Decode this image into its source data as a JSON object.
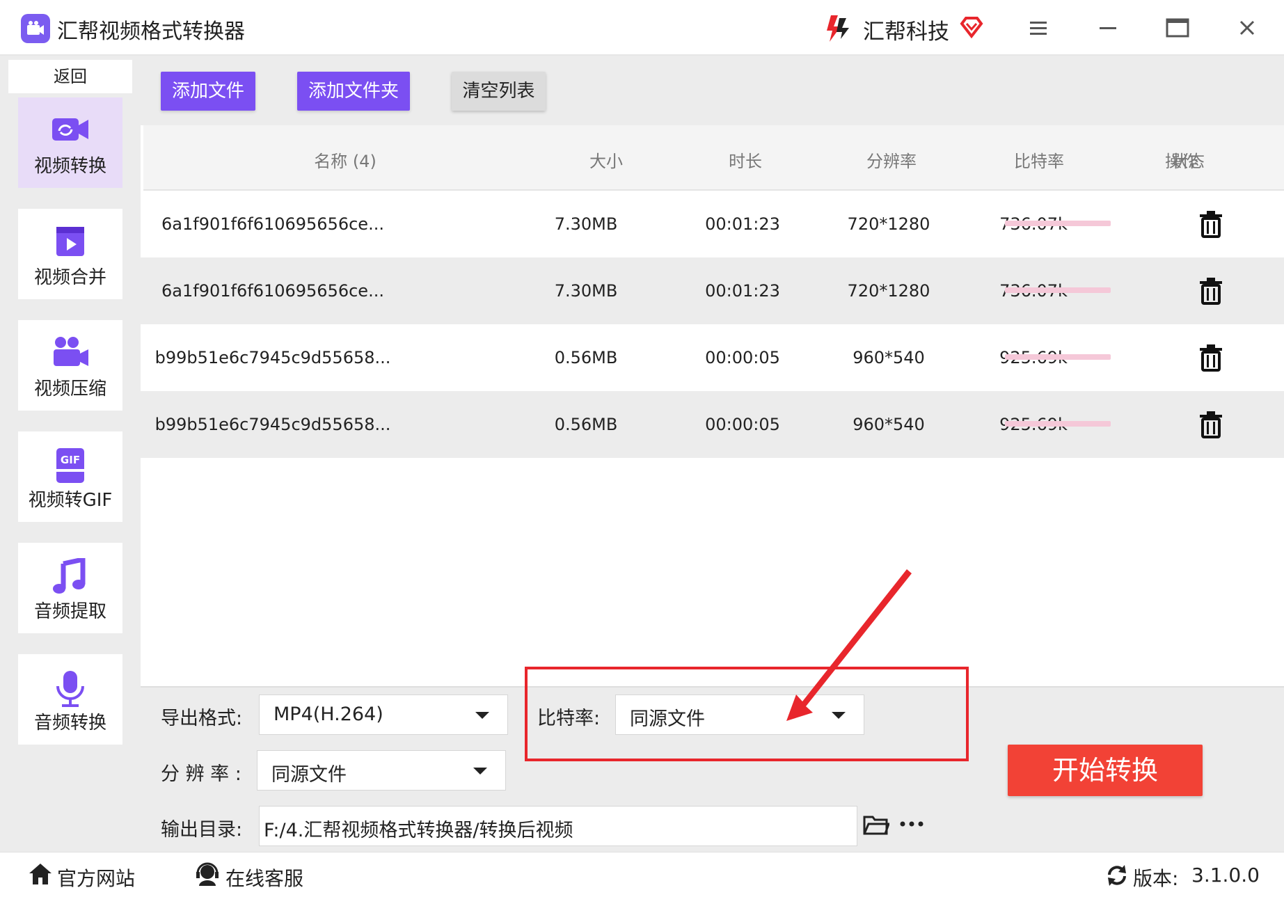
{
  "app": {
    "title": "汇帮视频格式转换器",
    "brand": "汇帮科技",
    "accent_color": "#7b4ff2",
    "start_color": "#f24236"
  },
  "window_controls": [
    "menu-icon",
    "minimize-icon",
    "maximize-icon",
    "close-icon"
  ],
  "sidebar": {
    "back_label": "返回",
    "items": [
      {
        "label": "视频转换",
        "icon": "video-convert-icon",
        "active": true
      },
      {
        "label": "视频合并",
        "icon": "video-merge-icon",
        "active": false
      },
      {
        "label": "视频压缩",
        "icon": "video-compress-icon",
        "active": false
      },
      {
        "label": "视频转GIF",
        "icon": "gif-icon",
        "active": false
      },
      {
        "label": "音频提取",
        "icon": "music-note-icon",
        "active": false
      },
      {
        "label": "音频转换",
        "icon": "microphone-icon",
        "active": false
      }
    ]
  },
  "toolbar": {
    "add_file": "添加文件",
    "add_folder": "添加文件夹",
    "clear_list": "清空列表"
  },
  "table": {
    "columns": [
      "名称 (4)",
      "大小",
      "时长",
      "分辨率",
      "比特率",
      "状态",
      "操作"
    ],
    "rows": [
      {
        "name": "6a1f901f6f610695656ce...",
        "size": "7.30MB",
        "duration": "00:01:23",
        "resolution": "720*1280",
        "bitrate": "736.07k",
        "progress": 0
      },
      {
        "name": "6a1f901f6f610695656ce...",
        "size": "7.30MB",
        "duration": "00:01:23",
        "resolution": "720*1280",
        "bitrate": "736.07k",
        "progress": 0
      },
      {
        "name": "b99b51e6c7945c9d55658...",
        "size": "0.56MB",
        "duration": "00:00:05",
        "resolution": "960*540",
        "bitrate": "925.69k",
        "progress": 0
      },
      {
        "name": "b99b51e6c7945c9d55658...",
        "size": "0.56MB",
        "duration": "00:00:05",
        "resolution": "960*540",
        "bitrate": "925.69k",
        "progress": 0
      }
    ]
  },
  "settings": {
    "format_label": "导出格式:",
    "format_value": "MP4(H.264)",
    "bitrate_label": "比特率:",
    "bitrate_value": "同源文件",
    "resolution_label": "分 辨 率 :",
    "resolution_value": "同源文件",
    "output_label": "输出目录:",
    "output_path": "F:/4.汇帮视频格式转换器/转换后视频",
    "start_label": "开始转换"
  },
  "footer": {
    "website": "官方网站",
    "support": "在线客服",
    "version_label": "版本:",
    "version": "3.1.0.0"
  }
}
